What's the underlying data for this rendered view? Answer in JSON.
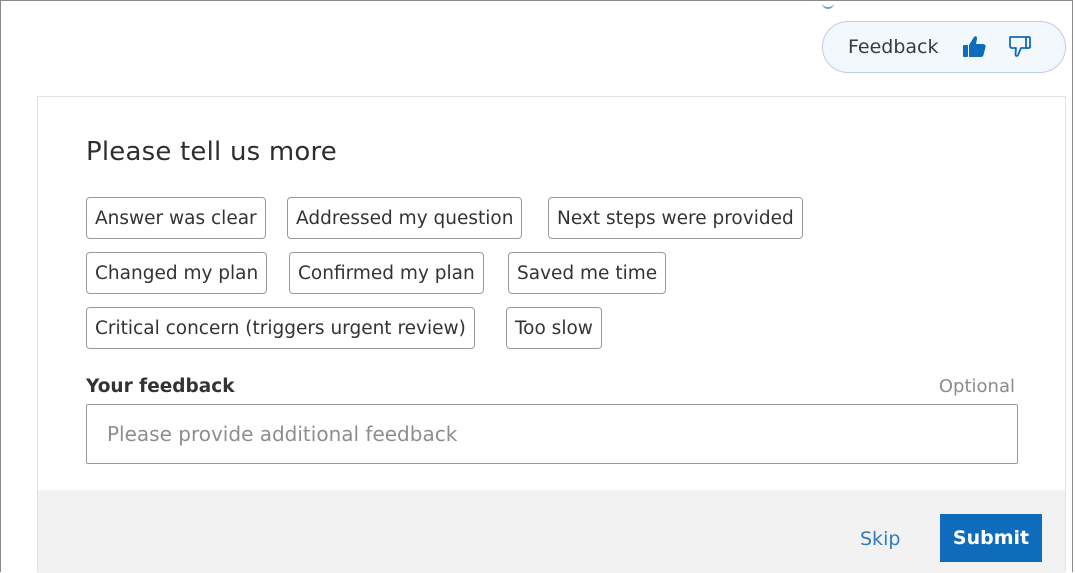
{
  "feedback_pill": {
    "label": "Feedback",
    "icons": [
      "thumbs-up-icon",
      "thumbs-down-icon"
    ]
  },
  "card": {
    "title": "Please tell us more",
    "chips": [
      "Answer was clear",
      "Addressed my question",
      "Next steps were provided",
      "Changed my plan",
      "Confirmed my plan",
      "Saved me time",
      "Critical concern (triggers urgent review)",
      "Too slow"
    ],
    "feedback_label": "Your feedback",
    "optional_label": "Optional",
    "feedback_placeholder": "Please provide additional feedback",
    "feedback_value": ""
  },
  "footer": {
    "skip_label": "Skip",
    "submit_label": "Submit"
  },
  "colors": {
    "accent": "#0f6cbd",
    "link": "#2f7bbf",
    "pill_border": "#b9d0e8",
    "pill_background": "#f3f8fd",
    "footer_background": "#f2f2f2"
  }
}
